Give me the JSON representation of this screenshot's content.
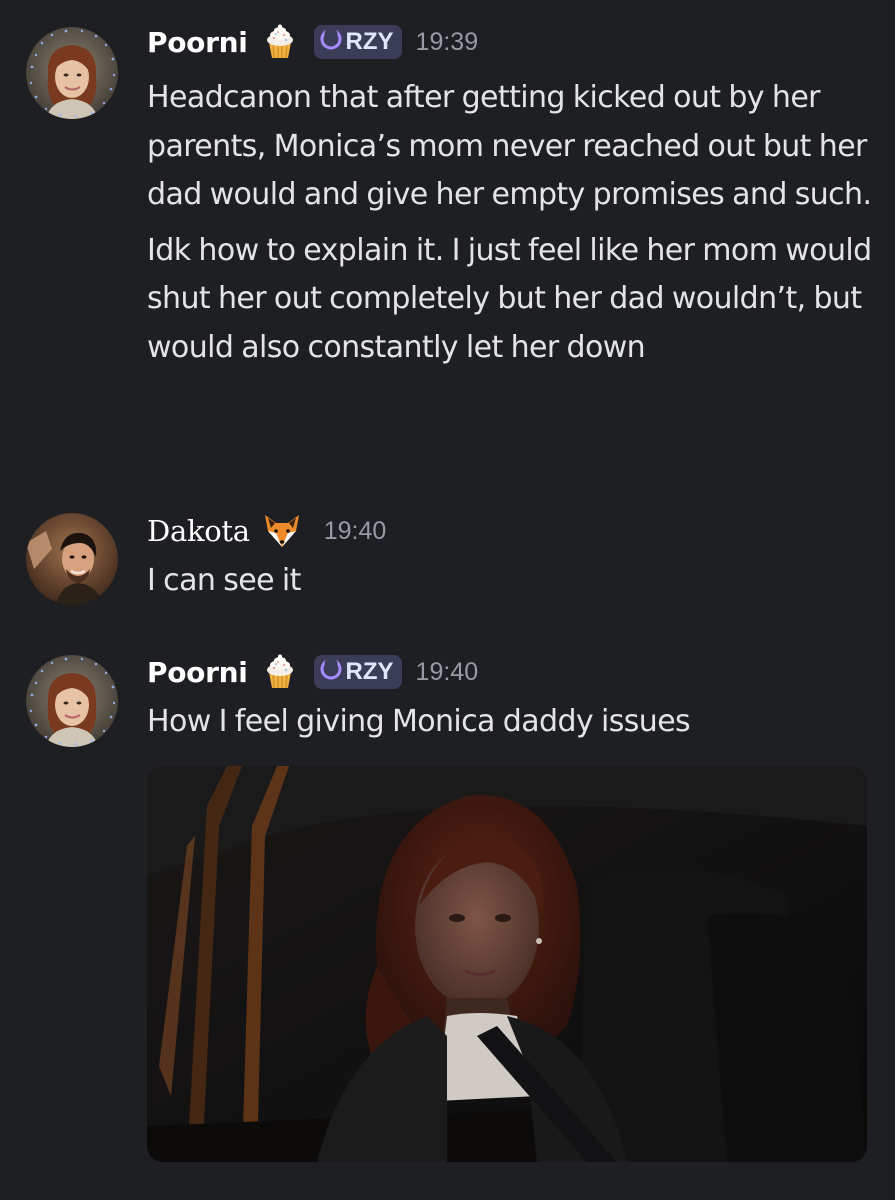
{
  "messages": [
    {
      "author": "Poorni",
      "author_emoji": "cupcake-icon",
      "tag": "RZY",
      "timestamp": "19:39",
      "paragraphs": [
        "Headcanon that after getting kicked out by her parents, Monica’s mom never reached out but her dad would and give her empty promises and such.",
        "Idk how to explain it. I just feel like her mom would shut her out completely but her dad wouldn’t, but would also constantly let her down"
      ]
    },
    {
      "author": "Dakota",
      "author_emoji": "fox-icon",
      "timestamp": "19:40",
      "paragraphs": [
        "I can see it"
      ]
    },
    {
      "author": "Poorni",
      "author_emoji": "cupcake-icon",
      "tag": "RZY",
      "timestamp": "19:40",
      "paragraphs": [
        "How I feel giving Monica daddy issues"
      ],
      "attachment": "image"
    }
  ],
  "colors": {
    "background": "#1e1f22",
    "username": "#ffffff",
    "text": "#e3e4e7",
    "timestamp": "#949ba4",
    "tag_background": "#3b3d58",
    "tag_icon": "#a68cff"
  }
}
